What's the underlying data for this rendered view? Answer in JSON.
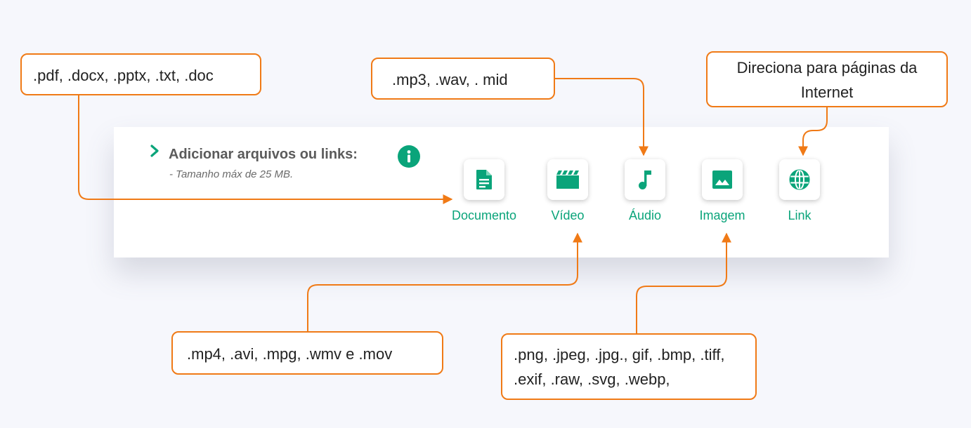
{
  "colors": {
    "accent": "#0aa47a",
    "callout_border": "#f07a16"
  },
  "section": {
    "title": "Adicionar arquivos ou links:",
    "subtitle": "- Tamanho máx de 25 MB.",
    "expand_icon": "chevron-right-icon",
    "info_icon": "info-icon"
  },
  "tiles": [
    {
      "label": "Documento",
      "icon": "document-icon"
    },
    {
      "label": "Vídeo",
      "icon": "video-icon"
    },
    {
      "label": "Áudio",
      "icon": "music-note-icon"
    },
    {
      "label": "Imagem",
      "icon": "image-icon"
    },
    {
      "label": "Link",
      "icon": "globe-icon"
    }
  ],
  "callouts": {
    "document": ".pdf, .docx, .pptx, .txt, .doc",
    "audio": ".mp3, .wav, . mid",
    "link": "Direciona para páginas da Internet",
    "video": ".mp4, .avi, .mpg, .wmv e .mov",
    "image": ".png, .jpeg, .jpg., gif, .bmp, .tiff, .exif, .raw, .svg, .webp,"
  }
}
